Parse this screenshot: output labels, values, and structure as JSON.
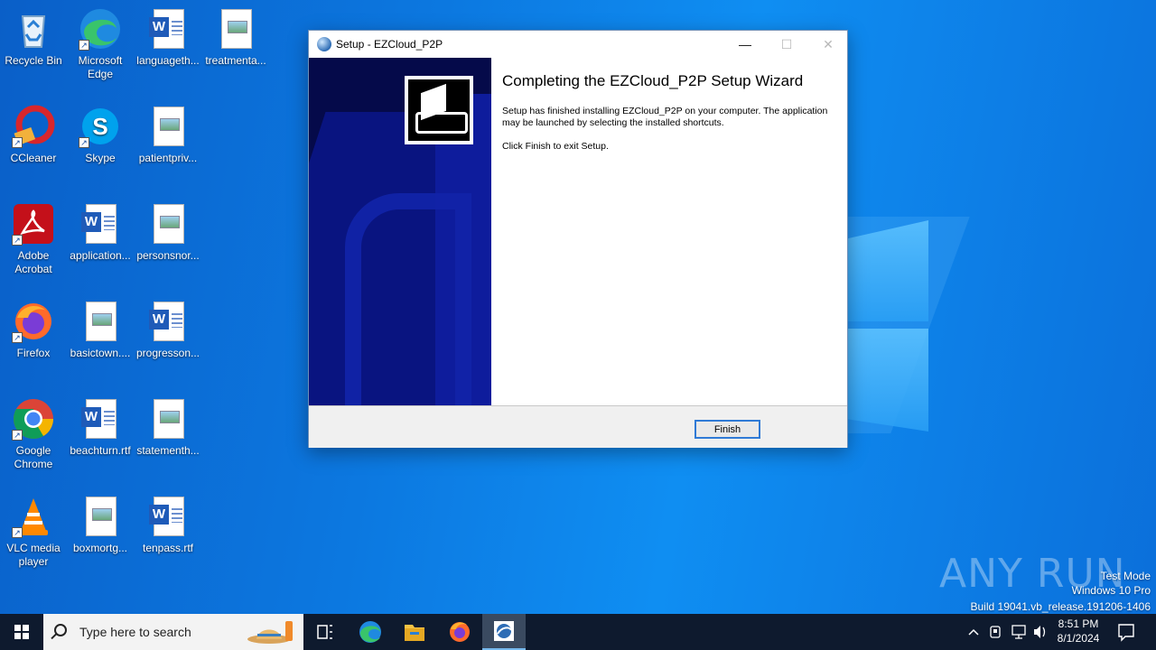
{
  "desktop": {
    "icons": [
      {
        "label": "Recycle Bin"
      },
      {
        "label": "Microsoft Edge"
      },
      {
        "label": "languageth..."
      },
      {
        "label": "treatmenta..."
      },
      {
        "label": "CCleaner"
      },
      {
        "label": "Skype"
      },
      {
        "label": "patientpriv..."
      },
      {
        "label": "Adobe Acrobat"
      },
      {
        "label": "application..."
      },
      {
        "label": "personsnor..."
      },
      {
        "label": "Firefox"
      },
      {
        "label": "basictown...."
      },
      {
        "label": "progresson..."
      },
      {
        "label": "Google Chrome"
      },
      {
        "label": "beachturn.rtf"
      },
      {
        "label": "statementh..."
      },
      {
        "label": "VLC media player"
      },
      {
        "label": "boxmortg..."
      },
      {
        "label": "tenpass.rtf"
      }
    ]
  },
  "window": {
    "title": "Setup - EZCloud_P2P",
    "minimize": "—",
    "maximize": "☐",
    "close": "✕",
    "heading": "Completing the EZCloud_P2P Setup Wizard",
    "paragraph1": "Setup has finished installing EZCloud_P2P on your computer. The application may be launched by selecting the installed shortcuts.",
    "paragraph2": "Click Finish to exit Setup.",
    "finish_label": "Finish"
  },
  "watermark": {
    "brand": "ANY RUN",
    "mode": "Test Mode",
    "edition": "Windows 10 Pro",
    "build": "Build 19041.vb_release.191206-1406"
  },
  "taskbar": {
    "search_placeholder": "Type here to search",
    "time": "8:51 PM",
    "date": "8/1/2024"
  },
  "colors": {
    "accent": "#2f7ad6",
    "taskbar": "#0e1a2e",
    "wizard_panel": "#050a4a"
  }
}
